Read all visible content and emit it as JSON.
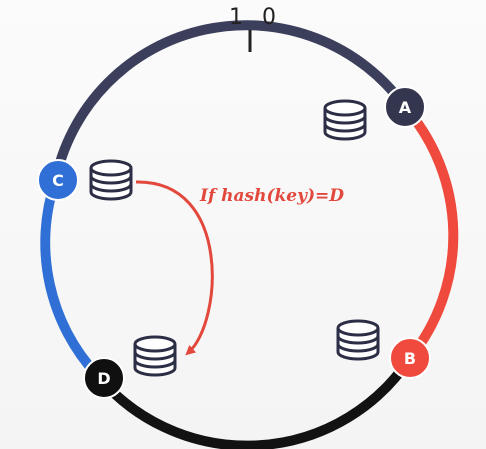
{
  "diagram": {
    "scale_label": "1 0",
    "annotation": "If hash(key)=D",
    "colors": {
      "arc_top": "#3c3f5c",
      "arc_right": "#ef4a3d",
      "arc_bottom": "#121212",
      "arc_left": "#2f6fd6",
      "annotation": "#e2483c",
      "server_stroke": "#2b2e45",
      "server_fill": "#ffffff"
    },
    "nodes": [
      {
        "id": "node-a",
        "label": "A",
        "color": "#34364f"
      },
      {
        "id": "node-b",
        "label": "B",
        "color": "#ef4a3d"
      },
      {
        "id": "node-c",
        "label": "C",
        "color": "#2f6fd6"
      },
      {
        "id": "node-d",
        "label": "D",
        "color": "#101010"
      }
    ],
    "servers": [
      "database-icon",
      "database-icon",
      "database-icon",
      "database-icon"
    ]
  }
}
